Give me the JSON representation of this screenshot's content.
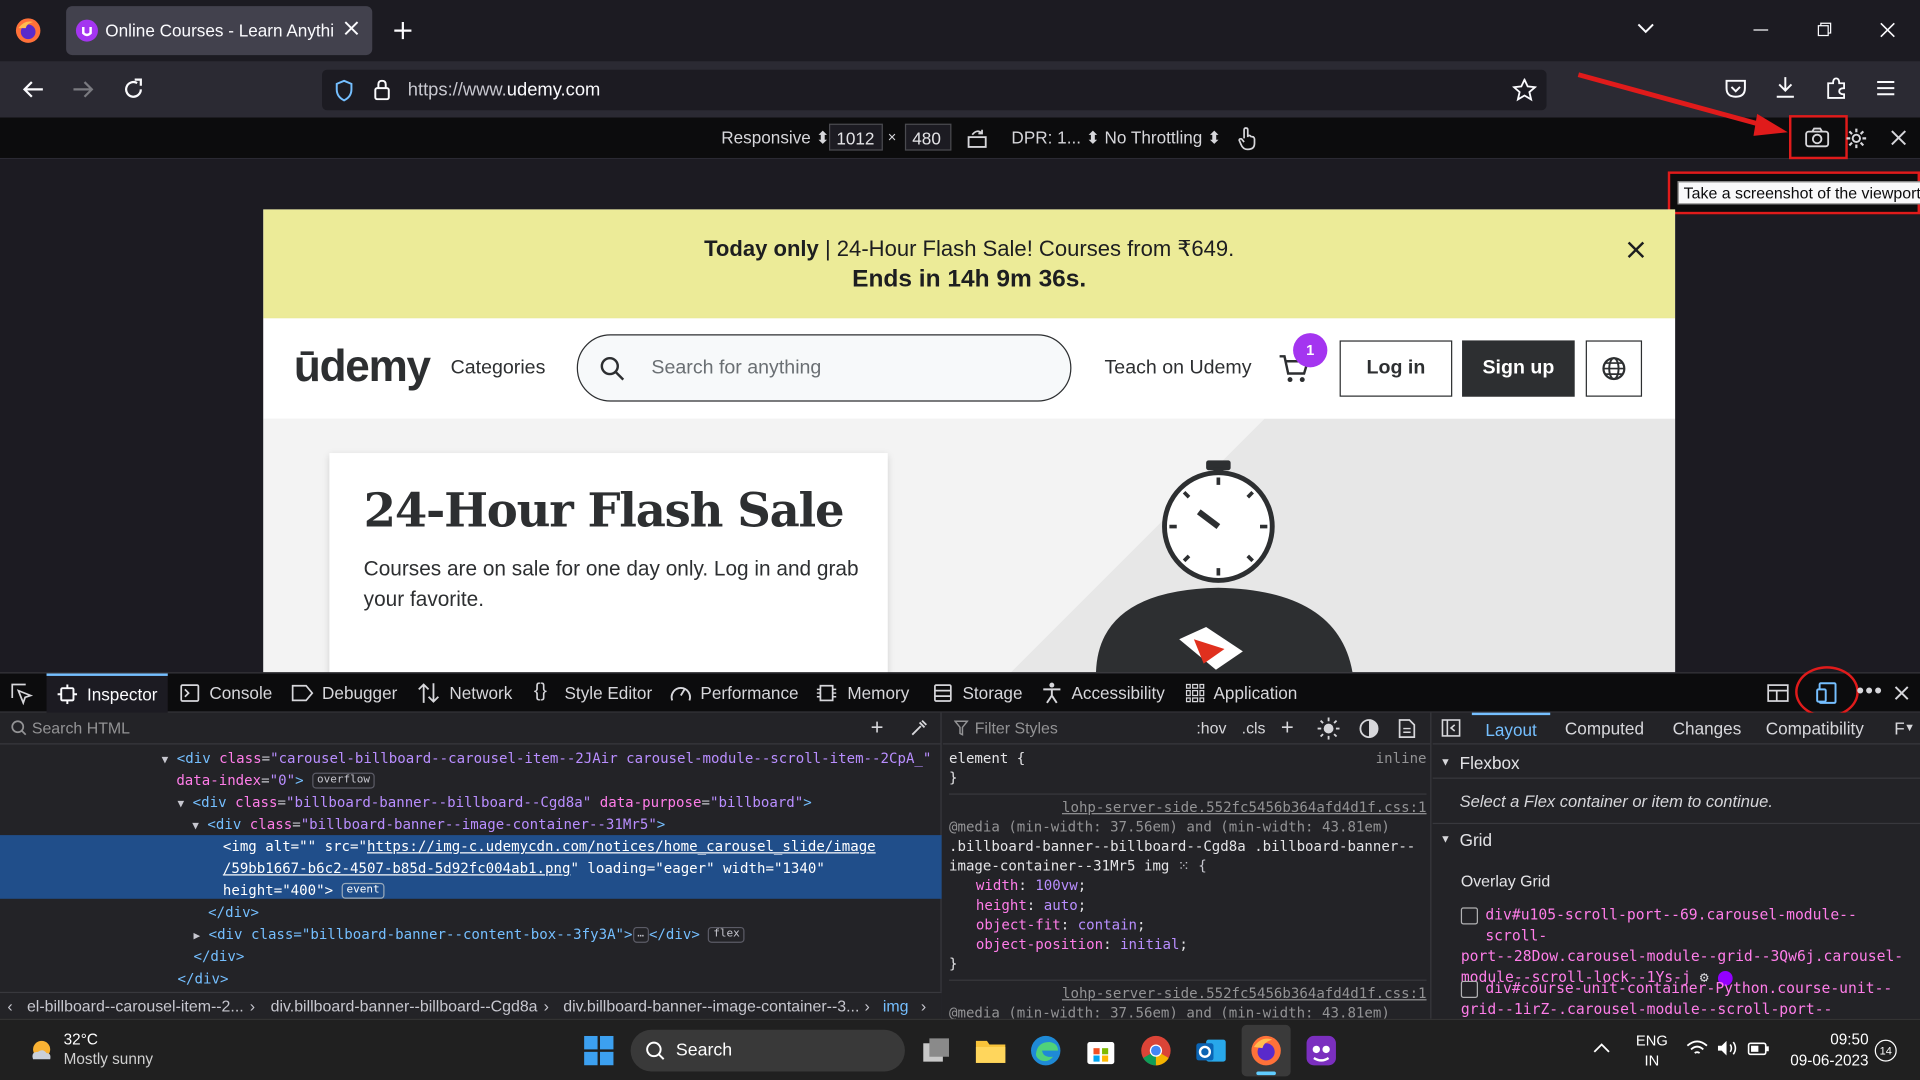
{
  "browser": {
    "tab_title": "Online Courses - Learn Anything, On Your Schedule",
    "url_prefix": "https://www.",
    "url_domain": "udemy.com"
  },
  "rdm": {
    "device": "Responsive",
    "width": "1012",
    "times": "×",
    "height": "480",
    "dpr": "DPR: 1...",
    "throttling": "No Throttling",
    "tooltip": "Take a screenshot of the viewport"
  },
  "page": {
    "banner": {
      "bold": "Today only",
      "text": " | 24-Hour Flash Sale! Courses from ₹649.",
      "countdown": "Ends in 14h 9m 36s."
    },
    "logo": "ūdemy",
    "categories": "Categories",
    "search_placeholder": "Search for anything",
    "teach": "Teach on Udemy",
    "cart_count": "1",
    "login": "Log in",
    "signup": "Sign up",
    "hero_title": "24-Hour Flash Sale",
    "hero_text": "Courses are on sale for one day only. Log in and grab your favorite."
  },
  "devtools": {
    "tabs": [
      "Inspector",
      "Console",
      "Debugger",
      "Network",
      "Style Editor",
      "Performance",
      "Memory",
      "Storage",
      "Accessibility",
      "Application"
    ],
    "search_html": "Search HTML",
    "html_lines": [
      {
        "tag": "div",
        "attrs": [
          [
            "class",
            "carousel-billboard--carousel-item--2JAir carousel-module--scroll-item--2CpA_"
          ]
        ],
        "tail": "",
        "extra_attr": "data-index",
        "extra_val": "0",
        "badge": "overflow"
      },
      {
        "tag": "div",
        "attrs": [
          [
            "class",
            "billboard-banner--billboard--Cgd8a"
          ],
          [
            "data-purpose",
            "billboard"
          ]
        ]
      },
      {
        "tag": "div",
        "attrs": [
          [
            "class",
            "billboard-banner--image-container--31Mr5"
          ]
        ]
      }
    ],
    "img_line1_pre": "<img alt=\"\" src=\"",
    "img_src1": "https://img-c.udemycdn.com/notices/home_carousel_slide/image",
    "img_src2": "/59bb1667-b6c2-4507-b85d-5d92fc004ab1.png",
    "img_loading": "loading=\"eager\" width=\"1340\"",
    "img_height": "height=\"400\">",
    "img_badge": "event",
    "close_div": "</div>",
    "content_box_line": "<div class=\"billboard-banner--content-box--3fy3A\">",
    "content_box_tail": "</div>",
    "flex_badge": "flex",
    "close_div2": "</div>",
    "close_div3": "</div>",
    "breadcrumbs": [
      "el-billboard--carousel-item--2...",
      "div.billboard-banner--billboard--Cgd8a",
      "div.billboard-banner--image-container--3...",
      "img"
    ],
    "filter_styles": "Filter Styles",
    "hov": ":hov",
    "cls": ".cls",
    "element_rule": "element {",
    "inline": "inline",
    "close_brace": "}",
    "source1": "lohp-server-side.552fc5456b364afd4d1f.css:1",
    "media1": "@media (min-width: 37.56em) and (min-width: 43.81em)",
    "selector1": ".billboard-banner--billboard--Cgd8a .billboard-banner--",
    "selector2": "image-container--31Mr5 img",
    "props": [
      {
        "name": "width",
        "value": "100vw"
      },
      {
        "name": "height",
        "value": "auto"
      },
      {
        "name": "object-fit",
        "value": "contain"
      },
      {
        "name": "object-position",
        "value": "initial"
      }
    ],
    "source2": "lohp-server-side.552fc5456b364afd4d1f.css:1",
    "media2": "@media (min-width: 37.56em) and (min-width: 43.81em)",
    "layout_tabs": [
      "Layout",
      "Computed",
      "Changes",
      "Compatibility",
      "F"
    ],
    "flexbox_label": "Flexbox",
    "flexbox_hint": "Select a Flex container or item to continue.",
    "grid_label": "Grid",
    "overlay_grid": "Overlay Grid",
    "grid_item1_a": "div#u105-scroll-port--69.carousel-module--scroll-",
    "grid_item1_b": "port--28Dow.carousel-module--grid--3Qw6j.carousel-",
    "grid_item1_c": "module--scroll-lock--1Ys-j",
    "grid_item2_a": "div#course-unit-container-Python.course-unit--",
    "grid_item2_b": "grid--1irZ-.carousel-module--scroll-port--"
  },
  "taskbar": {
    "weather_temp": "32°C",
    "weather_desc": "Mostly sunny",
    "search": "Search",
    "lang1": "ENG",
    "lang2": "IN",
    "time": "09:50",
    "date": "09-06-2023",
    "notif": "14"
  },
  "colors": {
    "banner_bg": "#eceb98",
    "udemy_purple": "#a435f0",
    "selection": "#204e8a",
    "annotation_red": "#e01b1b"
  }
}
